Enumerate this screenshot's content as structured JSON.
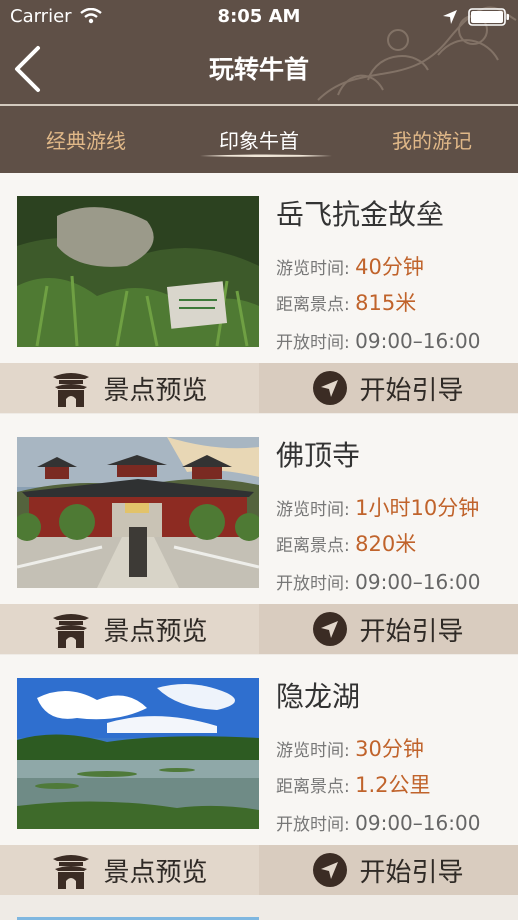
{
  "status_bar": {
    "carrier": "Carrier",
    "time": "8:05 AM"
  },
  "nav": {
    "title": "玩转牛首",
    "back_icon": "chevron-left-icon"
  },
  "tabs": [
    {
      "label": "经典游线",
      "active": false
    },
    {
      "label": "印象牛首",
      "active": true
    },
    {
      "label": "我的游记",
      "active": false
    }
  ],
  "colors": {
    "header_bg": "#5f5047",
    "tab_inactive": "#e0b888",
    "accent_value": "#c0632b",
    "action_preview_bg": "#e2d7cb",
    "action_guide_bg": "#d9ccbf"
  },
  "cards": [
    {
      "title": "岳飞抗金故垒",
      "duration_label": "游览时间:",
      "duration": "40分钟",
      "distance_label": "距离景点:",
      "distance": "815米",
      "hours_label": "开放时间:",
      "hours": "09:00–16:00",
      "preview_label": "景点预览",
      "guide_label": "开始引导"
    },
    {
      "title": "佛顶寺",
      "duration_label": "游览时间:",
      "duration": "1小时10分钟",
      "distance_label": "距离景点:",
      "distance": "820米",
      "hours_label": "开放时间:",
      "hours": "09:00–16:00",
      "preview_label": "景点预览",
      "guide_label": "开始引导"
    },
    {
      "title": "隐龙湖",
      "duration_label": "游览时间:",
      "duration": "30分钟",
      "distance_label": "距离景点:",
      "distance": "1.2公里",
      "hours_label": "开放时间:",
      "hours": "09:00–16:00",
      "preview_label": "景点预览",
      "guide_label": "开始引导"
    }
  ]
}
